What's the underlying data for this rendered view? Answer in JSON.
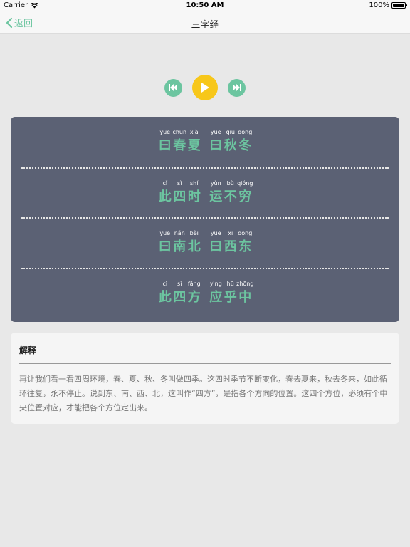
{
  "status": {
    "carrier": "Carrier",
    "time": "10:50 AM",
    "battery": "100%"
  },
  "nav": {
    "back_label": "返回",
    "title": "三字经"
  },
  "poem": {
    "lines": [
      [
        {
          "py": "yuē",
          "hz": "曰"
        },
        {
          "py": "chūn",
          "hz": "春"
        },
        {
          "py": "xià",
          "hz": "夏"
        },
        {
          "py": "",
          "hz": ""
        },
        {
          "py": "yuē",
          "hz": "曰"
        },
        {
          "py": "qiū",
          "hz": "秋"
        },
        {
          "py": "dōng",
          "hz": "冬"
        }
      ],
      [
        {
          "py": "cǐ",
          "hz": "此"
        },
        {
          "py": "sì",
          "hz": "四"
        },
        {
          "py": "shí",
          "hz": "时"
        },
        {
          "py": "",
          "hz": ""
        },
        {
          "py": "yùn",
          "hz": "运"
        },
        {
          "py": "bù",
          "hz": "不"
        },
        {
          "py": "qióng",
          "hz": "穷"
        }
      ],
      [
        {
          "py": "yuē",
          "hz": "曰"
        },
        {
          "py": "nán",
          "hz": "南"
        },
        {
          "py": "běi",
          "hz": "北"
        },
        {
          "py": "",
          "hz": ""
        },
        {
          "py": "yuē",
          "hz": "曰"
        },
        {
          "py": "xī",
          "hz": "西"
        },
        {
          "py": "dōng",
          "hz": "东"
        }
      ],
      [
        {
          "py": "cǐ",
          "hz": "此"
        },
        {
          "py": "sì",
          "hz": "四"
        },
        {
          "py": "fāng",
          "hz": "方"
        },
        {
          "py": "",
          "hz": ""
        },
        {
          "py": "yìng",
          "hz": "应"
        },
        {
          "py": "hū",
          "hz": "乎"
        },
        {
          "py": "zhōng",
          "hz": "中"
        }
      ]
    ]
  },
  "explain": {
    "title": "解释",
    "text": "再让我们看一看四周环境，春、夏、秋、冬叫做四季。这四时季节不断变化，春去夏来，秋去冬来，如此循环往复，永不停止。说到东、南、西、北，这叫作“四方”，是指各个方向的位置。这四个方位，必须有个中央位置对应，才能把各个方位定出来。"
  },
  "colors": {
    "accent": "#6cc5a0",
    "play": "#f7c71a",
    "panel": "#5b6174"
  },
  "icons": {
    "prev": "rewind-icon",
    "play": "play-icon",
    "next": "fast-forward-icon",
    "back": "chevron-left-icon",
    "wifi": "wifi-icon",
    "battery": "battery-icon"
  }
}
